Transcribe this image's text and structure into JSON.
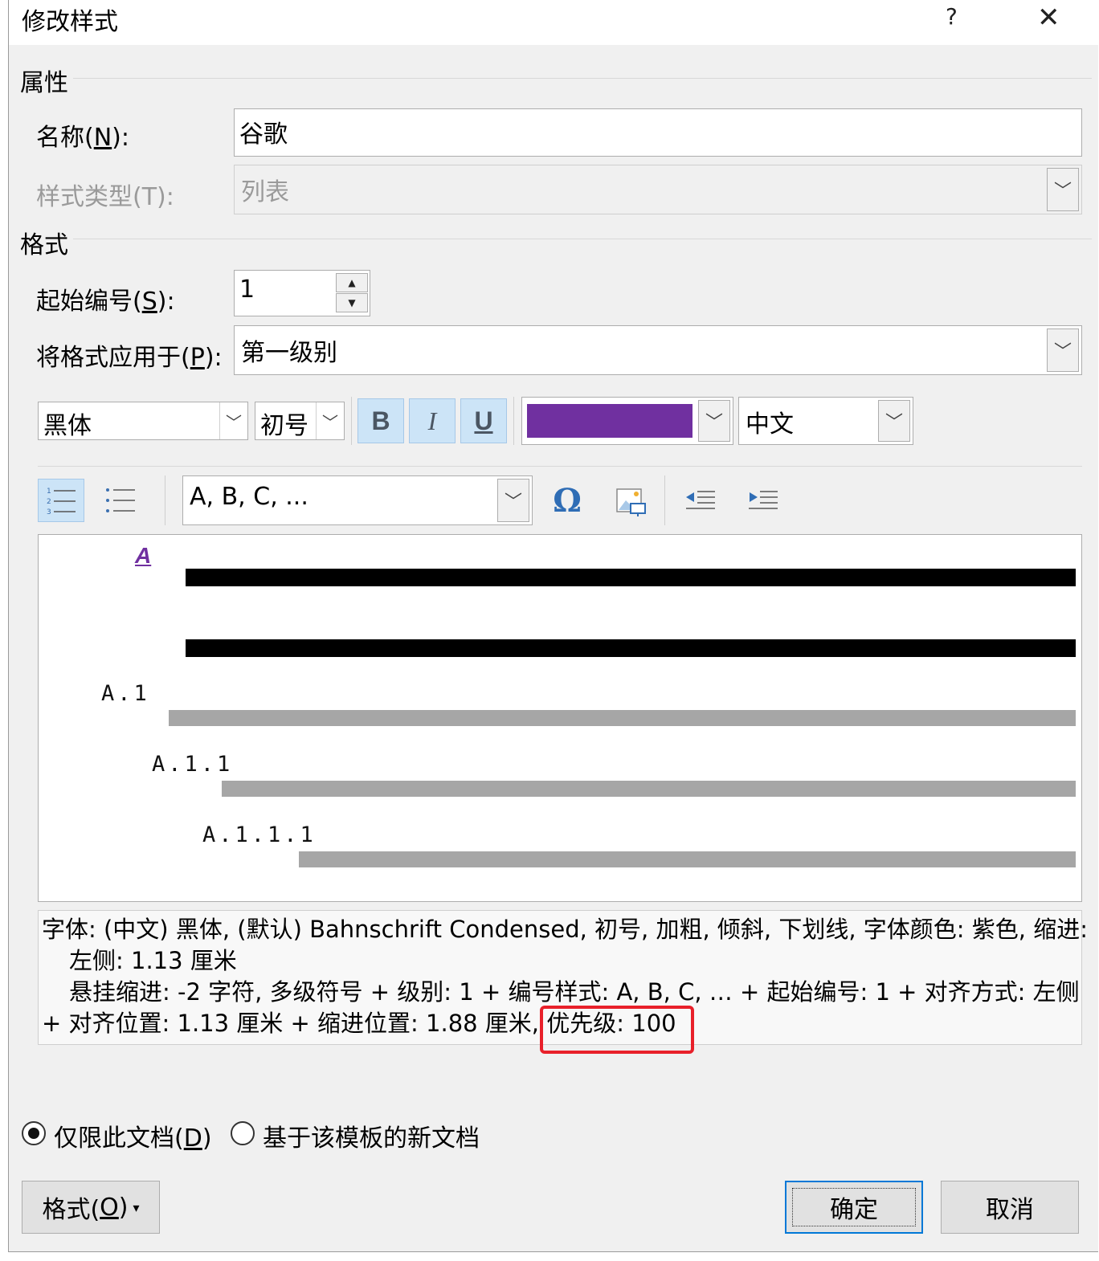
{
  "dialog": {
    "title": "修改样式",
    "help": "?",
    "close": "✕"
  },
  "properties": {
    "section": "属性",
    "name_label": "名称(",
    "name_key": "N",
    "name_tail": "):",
    "name_value": "谷歌",
    "type_label": "样式类型(T):",
    "type_value": "列表"
  },
  "format": {
    "section": "格式",
    "start_label": "起始编号(",
    "start_key": "S",
    "start_tail": "):",
    "start_value": "1",
    "apply_label": "将格式应用于(",
    "apply_key": "P",
    "apply_tail": "):",
    "apply_value": "第一级别"
  },
  "font_toolbar": {
    "font": "黑体",
    "size": "初号",
    "bold": "B",
    "italic": "I",
    "underline": "U",
    "color": "#7030a0",
    "script": "中文"
  },
  "list_toolbar": {
    "number_style": "A, B, C, ..."
  },
  "preview": {
    "marker": "A",
    "level2": "A.1",
    "level3": "A.1.1",
    "level4": "A.1.1.1"
  },
  "description": {
    "line1": "字体: (中文) 黑体, (默认) Bahnschrift Condensed, 初号, 加粗, 倾斜, 下划线, 字体颜色: 紫色, 缩进:",
    "line2": "左侧:  1.13 厘米",
    "line3": "悬挂缩进: -2 字符, 多级符号 + 级别: 1 + 编号样式: A, B, C, … + 起始编号: 1 + 对齐方式: 左侧",
    "line4a": "+ 对齐位置:  1.13 厘米 + 缩进位置:  1.88 厘米, ",
    "line4b": "优先级: 100"
  },
  "scope": {
    "this_doc_label": "仅限此文档(",
    "this_doc_key": "D",
    "this_doc_tail": ")",
    "template_label": "基于该模板的新文档"
  },
  "buttons": {
    "format_label": "格式(",
    "format_key": "O",
    "format_tail": ")",
    "format_arrow": "▾",
    "ok": "确定",
    "cancel": "取消"
  }
}
